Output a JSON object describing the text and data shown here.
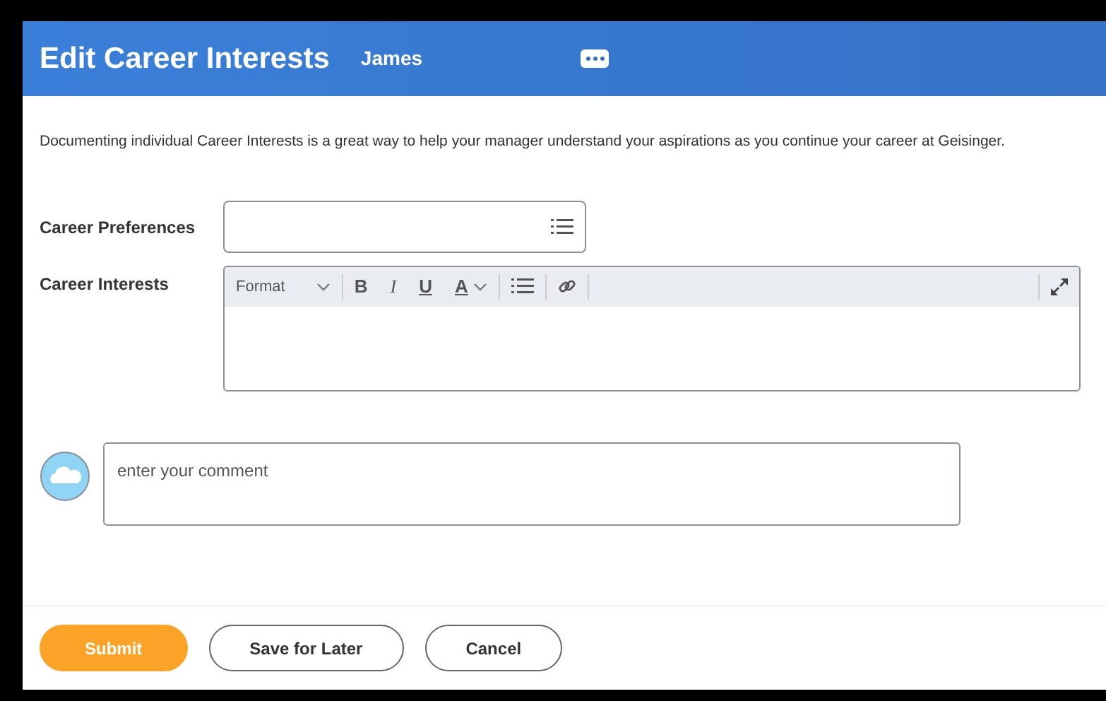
{
  "header": {
    "title": "Edit Career Interests",
    "subtitle": "James"
  },
  "intro": "Documenting individual Career Interests is a great way to help your manager understand your aspirations as you continue your career at Geisinger.",
  "fields": [
    {
      "kind": "prompt",
      "label": "Career Preferences"
    },
    {
      "kind": "richtext",
      "label": "Career Interests",
      "toolbar": [
        {
          "kind": "format",
          "label": "Format"
        },
        {
          "kind": "bold",
          "label": "B"
        },
        {
          "kind": "italic",
          "label": "I"
        },
        {
          "kind": "underline",
          "label": "U"
        },
        {
          "kind": "color",
          "label": "A"
        },
        {
          "kind": "list"
        },
        {
          "kind": "link"
        }
      ]
    }
  ],
  "comment": {
    "placeholder": "enter your comment"
  },
  "buttons": [
    {
      "label": "Submit",
      "kind": "primary"
    },
    {
      "label": "Save for Later",
      "kind": "outline"
    },
    {
      "label": "Cancel",
      "kind": "outline"
    }
  ]
}
